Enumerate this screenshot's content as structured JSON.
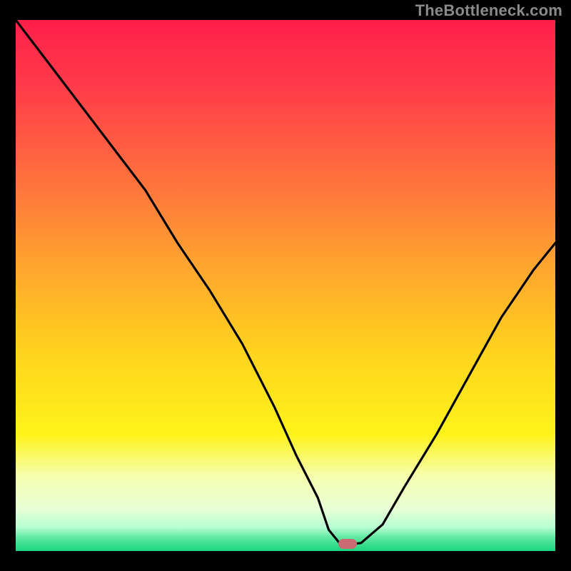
{
  "watermark": "TheBottleneck.com",
  "colors": {
    "bg_black": "#000000",
    "gradient_stops": [
      {
        "offset": 0.0,
        "color": "#ff1f4a"
      },
      {
        "offset": 0.12,
        "color": "#ff3a4a"
      },
      {
        "offset": 0.28,
        "color": "#ff6a3f"
      },
      {
        "offset": 0.45,
        "color": "#ffa130"
      },
      {
        "offset": 0.62,
        "color": "#ffd21e"
      },
      {
        "offset": 0.78,
        "color": "#fff31a"
      },
      {
        "offset": 0.86,
        "color": "#f6ffb0"
      },
      {
        "offset": 0.92,
        "color": "#e9ffd6"
      },
      {
        "offset": 0.955,
        "color": "#b8ffd2"
      },
      {
        "offset": 0.975,
        "color": "#5fe8a0"
      },
      {
        "offset": 1.0,
        "color": "#18d67e"
      }
    ],
    "curve": "#000000",
    "marker": "#cb6a70",
    "watermark": "#8a8a8a"
  },
  "chart_data": {
    "type": "line",
    "title": "",
    "xlabel": "",
    "ylabel": "",
    "xlim": [
      0,
      100
    ],
    "ylim": [
      0,
      100
    ],
    "note": "Axes are implicit (no tick labels shown). Values are percentage positions read from the plot rectangle: x from left, y = height above bottom.",
    "series": [
      {
        "name": "bottleneck-curve",
        "x": [
          0,
          6,
          12,
          18,
          24,
          30,
          36,
          42,
          48,
          52,
          56,
          58,
          60,
          62,
          64,
          68,
          72,
          78,
          84,
          90,
          96,
          100
        ],
        "y": [
          100,
          92,
          84,
          76,
          68,
          58,
          49,
          39,
          27,
          18,
          10,
          4,
          1.5,
          1.3,
          1.5,
          5,
          12,
          22,
          33,
          44,
          53,
          58
        ]
      }
    ],
    "annotations": [
      {
        "name": "optimal-marker",
        "x": 61.5,
        "y": 1.3,
        "shape": "rounded-rect",
        "color": "#cb6a70"
      }
    ]
  }
}
